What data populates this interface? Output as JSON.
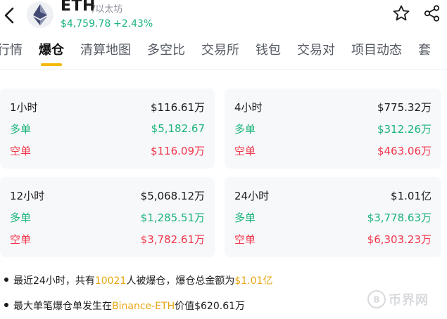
{
  "header": {
    "symbol": "ETH",
    "name": "/以太坊",
    "price": "$4,759.78",
    "change": "+2.43%"
  },
  "tabs": [
    {
      "label": "行情"
    },
    {
      "label": "爆仓"
    },
    {
      "label": "清算地图"
    },
    {
      "label": "多空比"
    },
    {
      "label": "交易所"
    },
    {
      "label": "钱包"
    },
    {
      "label": "交易对"
    },
    {
      "label": "项目动态"
    },
    {
      "label": "套"
    }
  ],
  "active_tab": "爆仓",
  "cards": [
    {
      "period": "1小时",
      "total": "$116.61万",
      "long_label": "多单",
      "long": "$5,182.67",
      "short_label": "空单",
      "short": "$116.09万"
    },
    {
      "period": "4小时",
      "total": "$775.32万",
      "long_label": "多单",
      "long": "$312.26万",
      "short_label": "空单",
      "short": "$463.06万"
    },
    {
      "period": "12小时",
      "total": "$5,068.12万",
      "long_label": "多单",
      "long": "$1,285.51万",
      "short_label": "空单",
      "short": "$3,782.61万"
    },
    {
      "period": "24小时",
      "total": "$1.01亿",
      "long_label": "多单",
      "long": "$3,778.63万",
      "short_label": "空单",
      "short": "$6,303.23万"
    }
  ],
  "notes": {
    "n1_pre": "最近24小时，共有",
    "n1_count": "10021",
    "n1_mid": "人被爆仓，爆仓总金额为",
    "n1_amount": "$1.01亿",
    "n2_pre": "最大单笔爆仓单发生在",
    "n2_exchange": "Binance-ETH",
    "n2_post": "价值$620.61万"
  },
  "watermark": {
    "text": "币界网"
  },
  "colors": {
    "up": "#1ab37a",
    "down": "#f0364a",
    "accent": "#f3b90b",
    "highlight": "#e7a611"
  }
}
